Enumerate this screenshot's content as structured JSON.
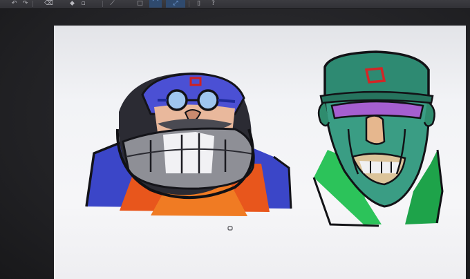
{
  "app": {
    "toolbar": {
      "buttons": [
        {
          "name": "undo-icon",
          "glyph": "↶"
        },
        {
          "name": "redo-icon",
          "glyph": "↷"
        },
        {
          "name": "clear-icon",
          "glyph": "⌫"
        },
        {
          "name": "fill-icon",
          "glyph": "◆"
        },
        {
          "name": "erase-icon",
          "glyph": "▫"
        },
        {
          "name": "select-icon",
          "glyph": "⟋"
        },
        {
          "name": "deselect-icon",
          "glyph": "□"
        },
        {
          "name": "lasso-icon",
          "glyph": "⌒"
        },
        {
          "name": "transform-icon",
          "glyph": "⤢"
        },
        {
          "name": "device-icon",
          "glyph": "▯"
        },
        {
          "name": "help-icon",
          "glyph": "?"
        }
      ]
    }
  },
  "canvas": {
    "artwork": [
      {
        "name": "goggles-character-sketch",
        "palette": [
          "#3b46c8",
          "#e84b1e",
          "#8e8f96",
          "#f4c9b0"
        ]
      },
      {
        "name": "cap-character-sketch",
        "palette": [
          "#2f8c6e",
          "#a55fd0",
          "#e6b78e",
          "#2cc35a"
        ]
      }
    ]
  }
}
